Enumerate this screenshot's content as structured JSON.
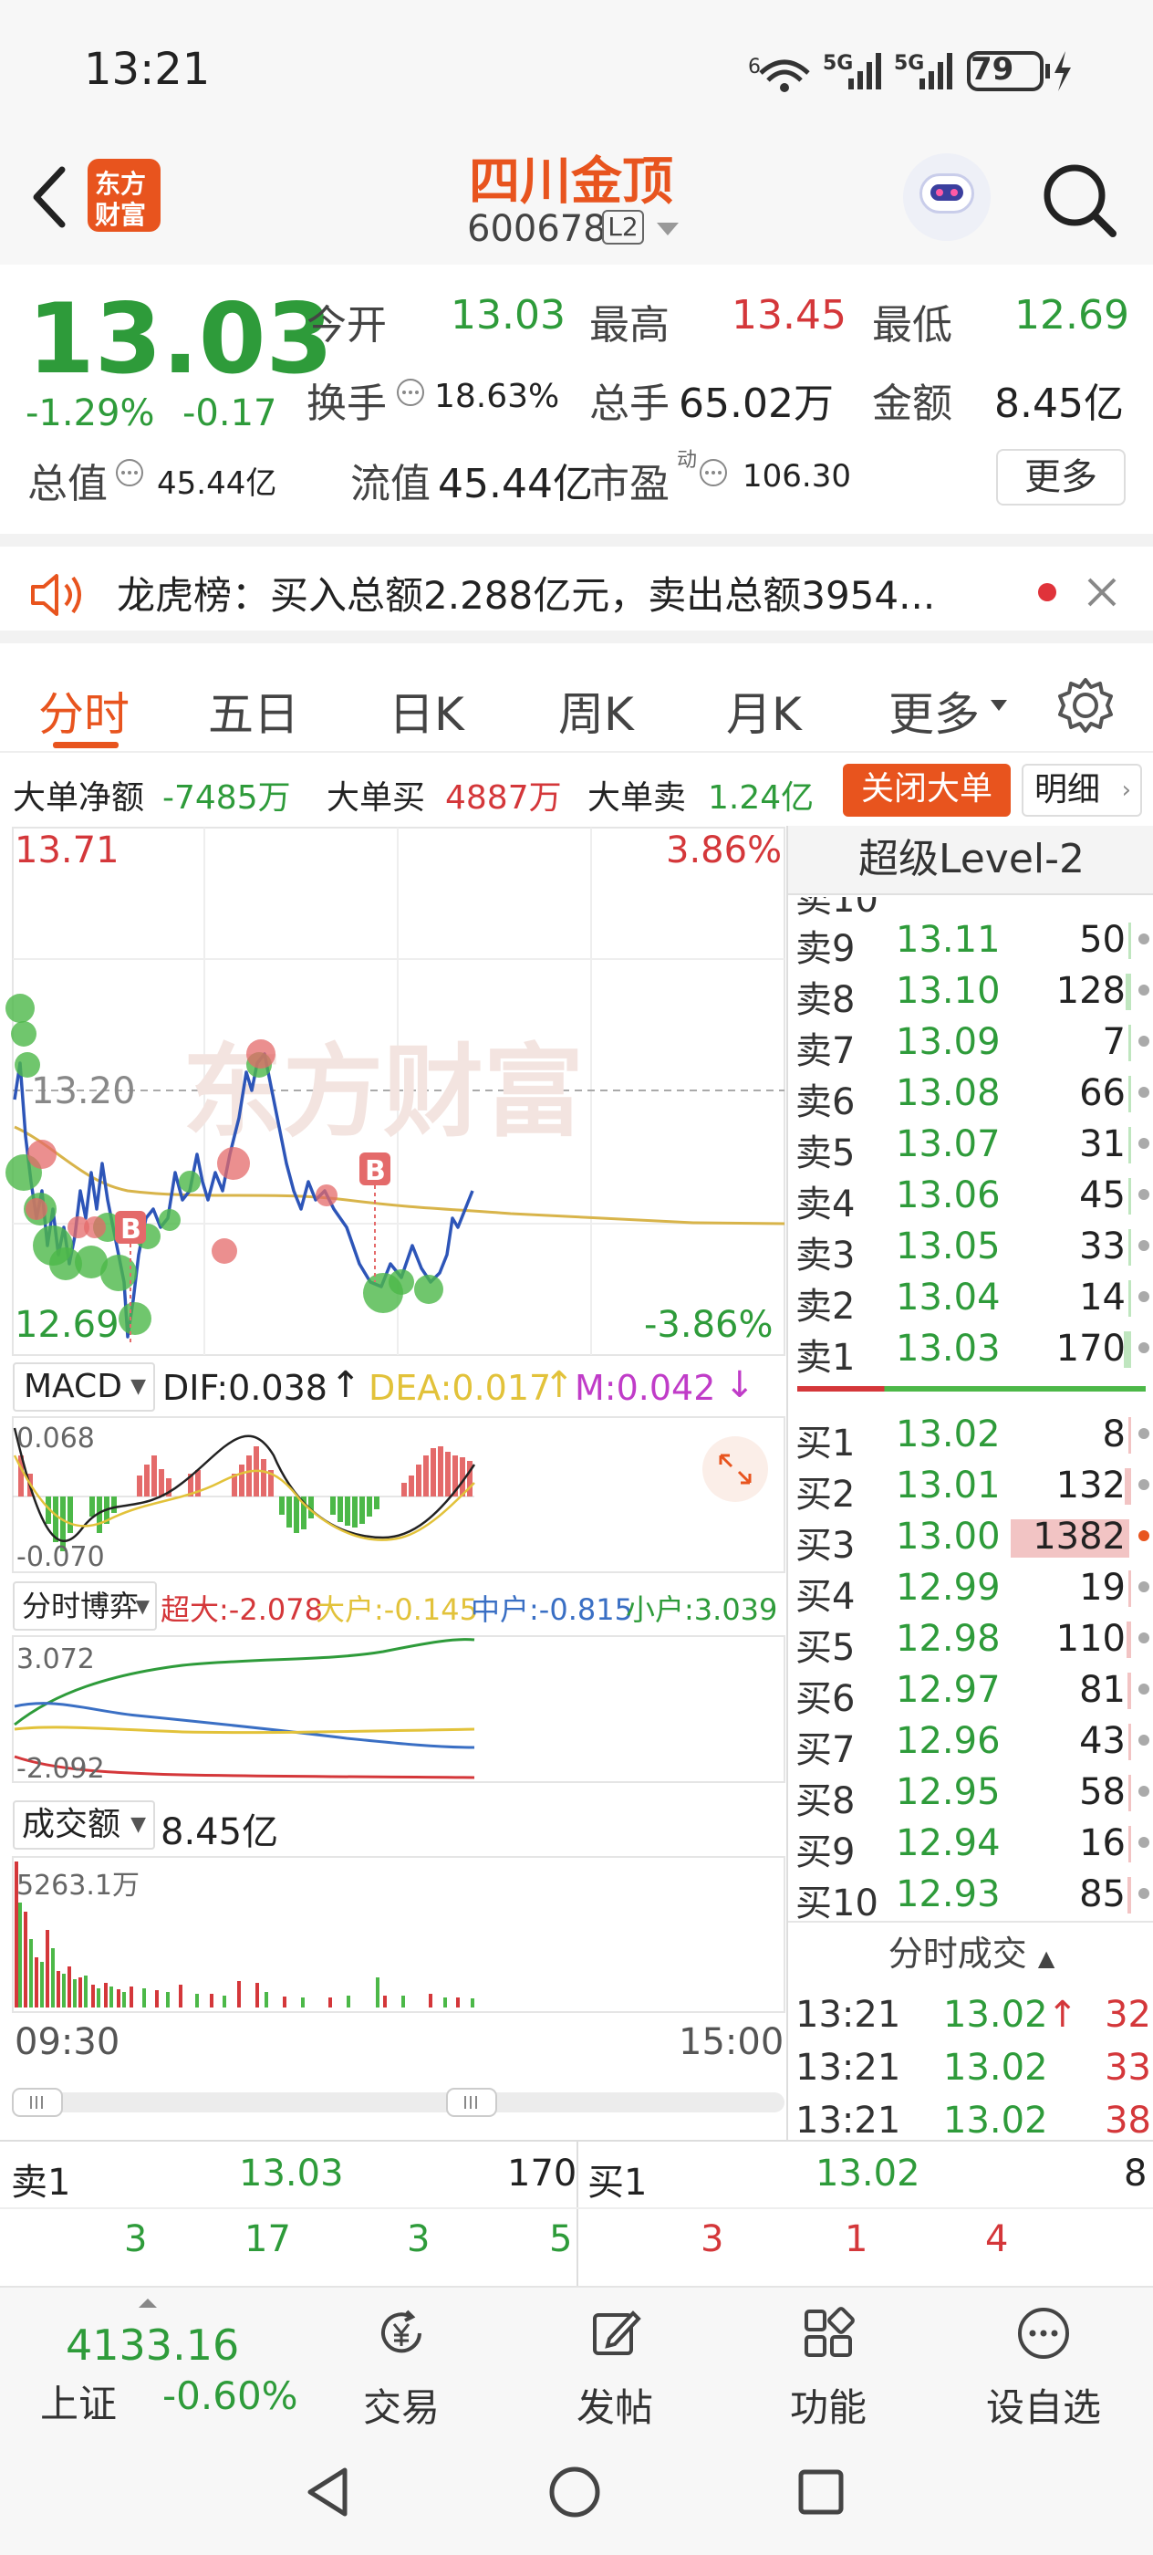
{
  "status": {
    "time": "13:21",
    "battery": "79"
  },
  "header": {
    "stock_name": "四川金顶",
    "stock_code": "600678",
    "level_badge": "L2",
    "logo_text_1": "东方",
    "logo_text_2": "财富"
  },
  "quote": {
    "price": "13.03",
    "change_pct": "-1.29%",
    "change": "-0.17",
    "open_label": "今开",
    "open": "13.03",
    "high_label": "最高",
    "high": "13.45",
    "low_label": "最低",
    "low": "12.69",
    "turnover_label": "换手",
    "turnover": "18.63%",
    "volume_label": "总手",
    "volume": "65.02万",
    "amount_label": "金额",
    "amount": "8.45亿",
    "mktcap_label": "总值",
    "mktcap": "45.44亿",
    "float_label": "流值",
    "float": "45.44亿",
    "pe_label": "市盈",
    "pe_sup": "动",
    "pe": "106.30",
    "more": "更多"
  },
  "notice": {
    "text": "龙虎榜：买入总额2.288亿元，卖出总额3954..."
  },
  "tabs": [
    "分时",
    "五日",
    "日K",
    "周K",
    "月K",
    "更多"
  ],
  "bigorder": {
    "net_label": "大单净额",
    "net": "-7485万",
    "buy_label": "大单买",
    "buy": "4887万",
    "sell_label": "大单卖",
    "sell": "1.24亿",
    "close_btn": "关闭大单",
    "detail_btn": "明细"
  },
  "chart": {
    "top_price": "13.71",
    "top_pct": "3.86%",
    "bottom_price": "12.69",
    "bottom_pct": "-3.86%",
    "mid_price": "13.20",
    "watermark": "东方财富",
    "b_marker": "B",
    "macd": {
      "label": "MACD",
      "dif": "DIF:0.038",
      "dea": "DEA:0.017",
      "m": "M:0.042",
      "top": "0.068",
      "bottom": "-0.070"
    },
    "fund": {
      "label": "分时博弈",
      "super": "超大:-2.078",
      "big": "大户:-0.145",
      "mid": "中户:-0.815",
      "small": "小户:3.039",
      "top": "3.072",
      "bottom": "-2.092"
    },
    "vol": {
      "label": "成交额",
      "total": "8.45亿",
      "max": "5263.1万"
    },
    "time_start": "09:30",
    "time_end": "15:00"
  },
  "level2": {
    "title": "超级Level-2",
    "sells": [
      {
        "label": "卖9",
        "price": "13.11",
        "vol": "50"
      },
      {
        "label": "卖8",
        "price": "13.10",
        "vol": "128"
      },
      {
        "label": "卖7",
        "price": "13.09",
        "vol": "7"
      },
      {
        "label": "卖6",
        "price": "13.08",
        "vol": "66"
      },
      {
        "label": "卖5",
        "price": "13.07",
        "vol": "31"
      },
      {
        "label": "卖4",
        "price": "13.06",
        "vol": "45"
      },
      {
        "label": "卖3",
        "price": "13.05",
        "vol": "33"
      },
      {
        "label": "卖2",
        "price": "13.04",
        "vol": "14"
      },
      {
        "label": "卖1",
        "price": "13.03",
        "vol": "170"
      }
    ],
    "buys": [
      {
        "label": "买1",
        "price": "13.02",
        "vol": "8"
      },
      {
        "label": "买2",
        "price": "13.01",
        "vol": "132"
      },
      {
        "label": "买3",
        "price": "13.00",
        "vol": "1382"
      },
      {
        "label": "买4",
        "price": "12.99",
        "vol": "19"
      },
      {
        "label": "买5",
        "price": "12.98",
        "vol": "110"
      },
      {
        "label": "买6",
        "price": "12.97",
        "vol": "81"
      },
      {
        "label": "买7",
        "price": "12.96",
        "vol": "43"
      },
      {
        "label": "买8",
        "price": "12.95",
        "vol": "58"
      },
      {
        "label": "买9",
        "price": "12.94",
        "vol": "16"
      },
      {
        "label": "买10",
        "price": "12.93",
        "vol": "85"
      }
    ],
    "trades_title": "分时成交",
    "trades": [
      {
        "time": "13:21",
        "price": "13.02",
        "vol": "32"
      },
      {
        "time": "13:21",
        "price": "13.02",
        "vol": "33"
      },
      {
        "time": "13:21",
        "price": "13.02",
        "vol": "38"
      }
    ]
  },
  "bottomquotes": {
    "sell_label": "卖1",
    "sell_price": "13.03",
    "sell_vol": "170",
    "buy_label": "买1",
    "buy_price": "13.02",
    "buy_vol": "8",
    "sell_queue": [
      "3",
      "17",
      "3",
      "5"
    ],
    "buy_queue": [
      "3",
      "1",
      "4"
    ]
  },
  "nav": {
    "index_value": "4133.16",
    "index_name": "上证",
    "index_pct": "-0.60%",
    "items": [
      "交易",
      "发帖",
      "功能",
      "设自选"
    ]
  }
}
